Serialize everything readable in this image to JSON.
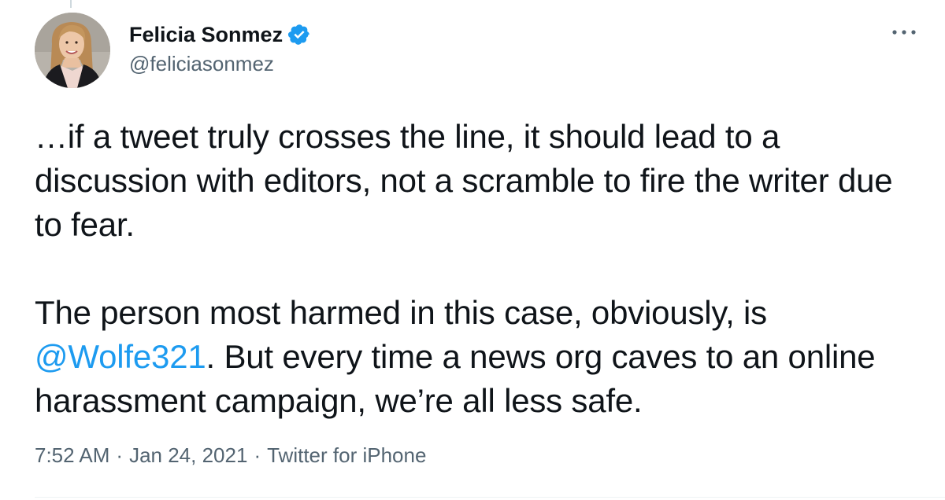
{
  "tweet": {
    "author": {
      "display_name": "Felicia Sonmez",
      "handle": "@feliciasonmez",
      "verified": true
    },
    "body": {
      "paragraph1": "…if a tweet truly crosses the line, it should lead to a discussion with editors, not a scramble to fire the writer due to fear.",
      "paragraph2_before": "The person most harmed in this case, obviously, is ",
      "mention": "@Wolfe321",
      "paragraph2_after": ". But every time a news org caves to an online harassment campaign, we’re all less safe."
    },
    "meta": {
      "time": "7:52 AM",
      "separator": "·",
      "date": "Jan 24, 2021",
      "source": "Twitter for iPhone"
    }
  },
  "colors": {
    "accent": "#1d9bf0",
    "text": "#0f1419",
    "secondary": "#536471"
  },
  "icons": {
    "verified": "verified-badge-icon",
    "more": "more-options-icon"
  }
}
